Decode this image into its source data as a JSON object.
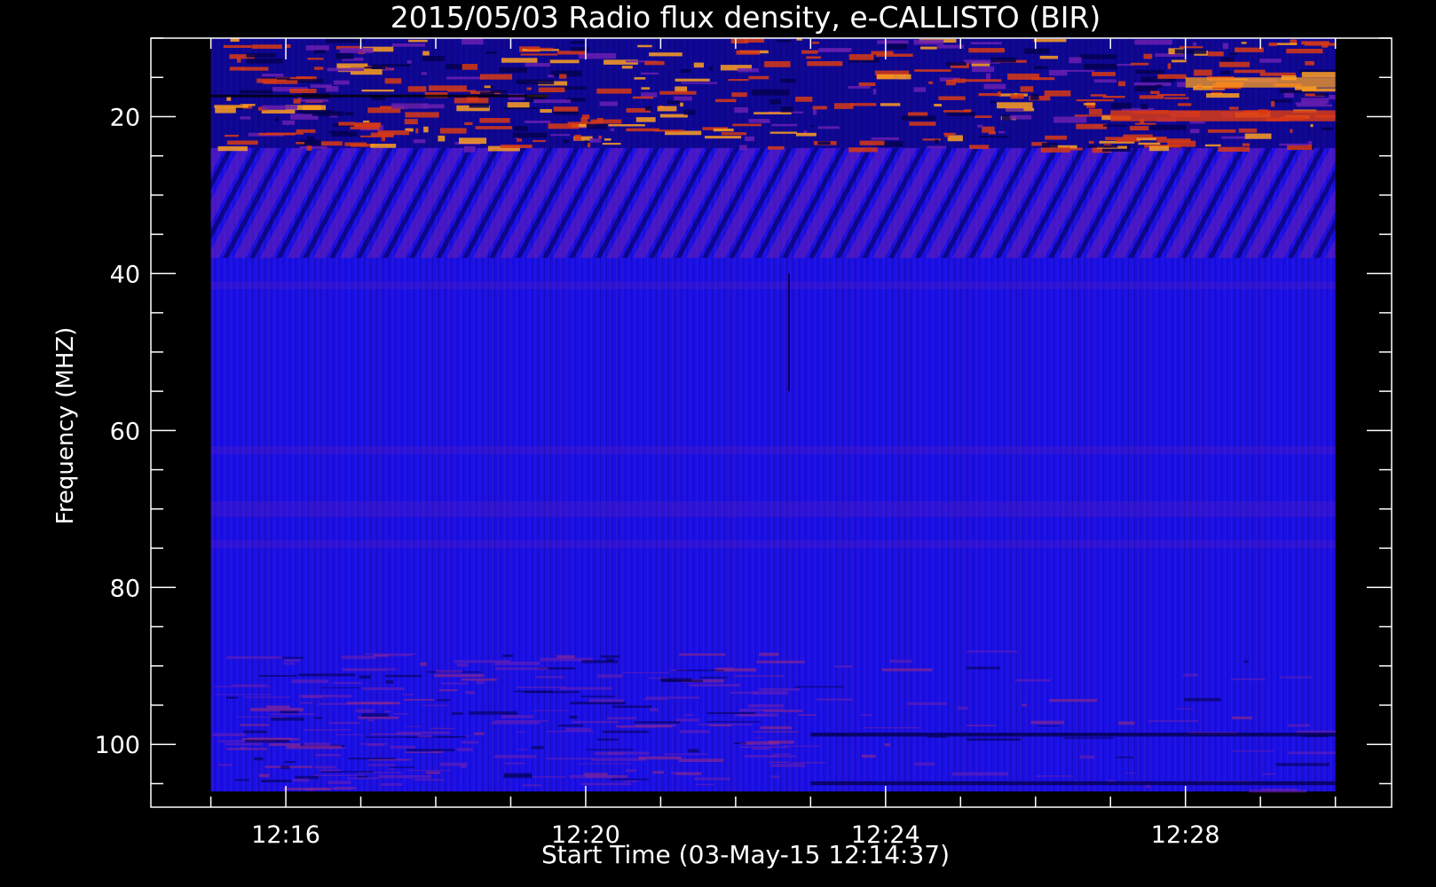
{
  "chart_data": {
    "type": "heatmap",
    "title": "2015/05/03  Radio flux density, e-CALLISTO (BIR)",
    "xlabel": "Start Time (03-May-15 12:14:37)",
    "ylabel": "Frequency (MHZ)",
    "x_ticks": [
      "12:16",
      "12:20",
      "12:24",
      "12:28"
    ],
    "x_tick_minutes": [
      16,
      20,
      24,
      28
    ],
    "x_range_minutes": [
      14.2,
      30.75
    ],
    "data_range_minutes": [
      15.0,
      30.0
    ],
    "y_ticks": [
      20,
      40,
      60,
      80,
      100
    ],
    "y_range": [
      10,
      108
    ],
    "data_freq_range": [
      10,
      106
    ],
    "y_inverted": true,
    "colors": {
      "background": "#000000",
      "axes": "#ffffff",
      "base": "#1a10e6",
      "quiet": "#0a00f0",
      "moderate": "#6a1fb0",
      "bright": "#d83a14",
      "hot": "#ffa020",
      "dark": "#050050"
    },
    "features": [
      {
        "name": "rfi-top-band",
        "freq_mhz": [
          10,
          24
        ],
        "intensity": "high"
      },
      {
        "name": "diagonal-stripes",
        "freq_mhz": [
          24,
          38
        ],
        "intensity": "moderate"
      },
      {
        "name": "lower-noise-band",
        "freq_mhz": [
          88,
          106
        ],
        "intensity": "moderate"
      },
      {
        "name": "vertical-line",
        "time_min": 22.7,
        "freq_mhz": [
          40,
          55
        ]
      }
    ]
  }
}
